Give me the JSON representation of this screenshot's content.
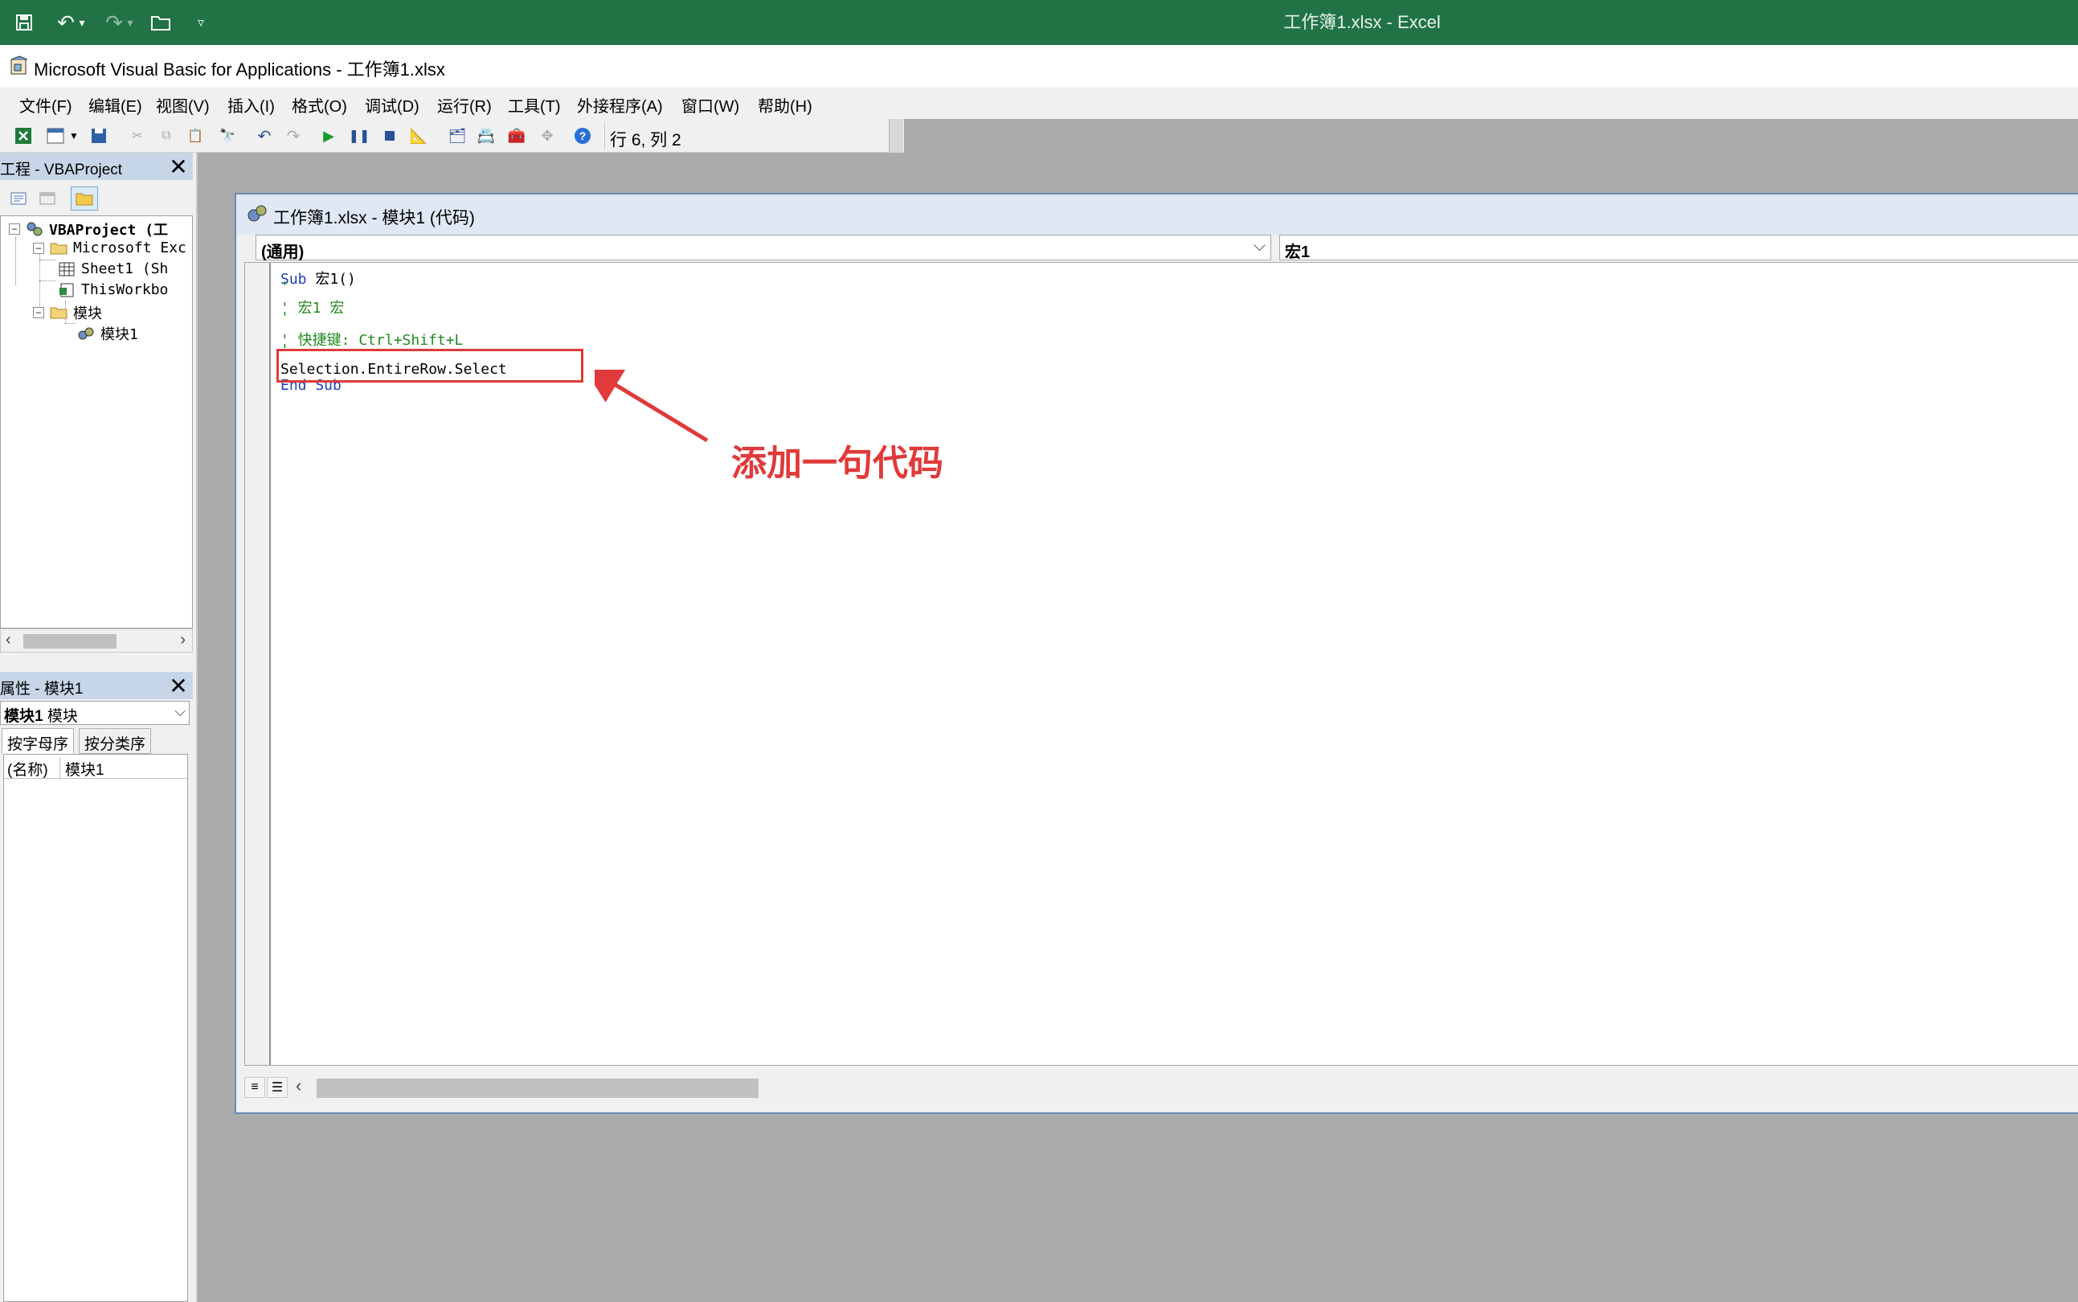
{
  "excel": {
    "title": "工作簿1.xlsx  -  Excel"
  },
  "vba": {
    "window_title": "Microsoft Visual Basic for Applications - 工作簿1.xlsx"
  },
  "menu": {
    "items": [
      "文件(F)",
      "编辑(E)",
      "视图(V)",
      "插入(I)",
      "格式(O)",
      "调试(D)",
      "运行(R)",
      "工具(T)",
      "外接程序(A)",
      "窗口(W)",
      "帮助(H)"
    ]
  },
  "toolbar": {
    "cursor_position": "行 6, 列 2"
  },
  "project_pane": {
    "title": "工程 - VBAProject",
    "tree": {
      "root": "VBAProject (工",
      "excel_objects": "Microsoft Exc",
      "sheet1": "Sheet1 (Sh",
      "thisworkbook": "ThisWorkbo",
      "modules": "模块",
      "module1": "模块1"
    }
  },
  "properties_pane": {
    "title": "属性 - 模块1",
    "object_combo_name": "模块1",
    "object_combo_type": "模块",
    "tab_alpha": "按字母序",
    "tab_category": "按分类序",
    "row_key": "(名称)",
    "row_value": "模块1"
  },
  "code_window": {
    "title": "工作簿1.xlsx - 模块1 (代码)",
    "object_combo": "(通用)",
    "proc_combo": "宏1",
    "lines": {
      "l1_kw": "Sub",
      "l1_rest": " 宏1()",
      "l2": "'",
      "l3": "' 宏1 宏",
      "l4": "'",
      "l5": "' 快捷键: Ctrl+Shift+L",
      "l6": "'",
      "l7": "Selection.EntireRow.Select",
      "l8": "End Sub"
    }
  },
  "annotation": {
    "text": "添加一句代码",
    "color": "#e03a3a"
  },
  "colors": {
    "excel_green": "#217346",
    "mdi_background": "#ababab",
    "keyword": "#1f3fb8",
    "comment": "#218a21"
  }
}
